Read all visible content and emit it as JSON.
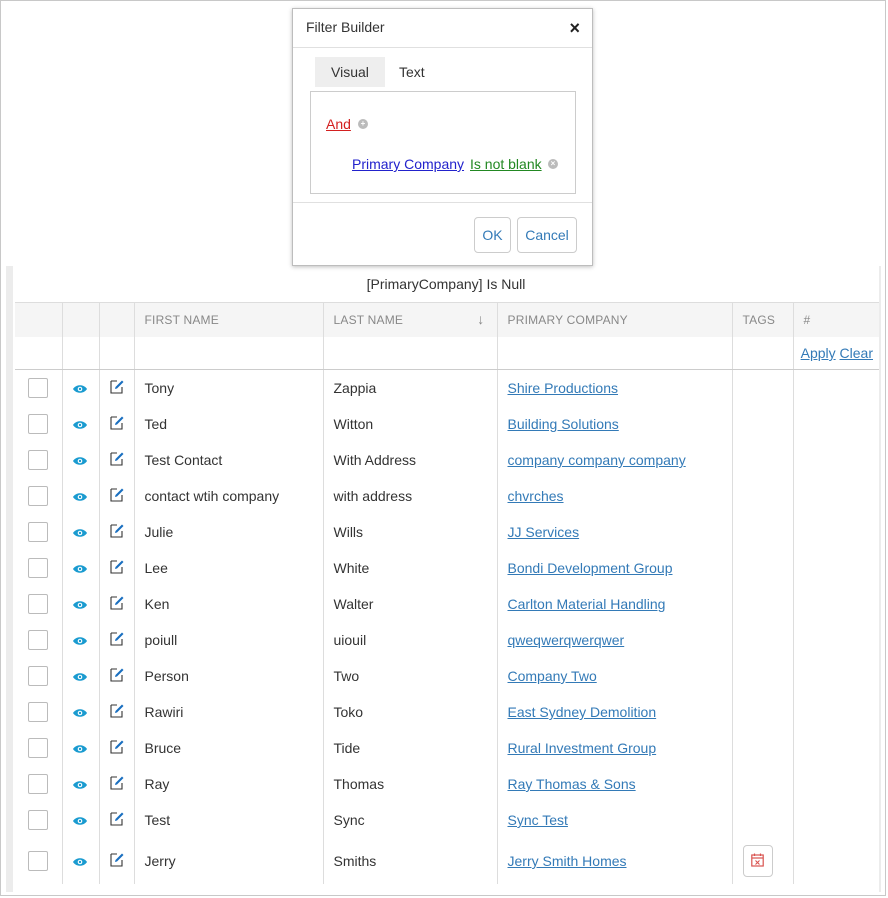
{
  "dialog": {
    "title": "Filter Builder",
    "close": "×",
    "tabs": [
      {
        "label": "Visual",
        "active": true
      },
      {
        "label": "Text",
        "active": false
      }
    ],
    "group_operator": "And",
    "condition": {
      "field": "Primary Company",
      "operator": "Is not blank"
    },
    "ok_label": "OK",
    "cancel_label": "Cancel"
  },
  "filter_expression": "[PrimaryCompany] Is Null",
  "grid": {
    "columns": {
      "first_name": "FIRST NAME",
      "last_name": "LAST NAME",
      "primary_company": "PRIMARY COMPANY",
      "tags": "TAGS",
      "hash": "#"
    },
    "sort_indicator": "↓",
    "filter_apply": "Apply",
    "filter_clear": "Clear",
    "rows": [
      {
        "first": "Tony",
        "last": "Zappia",
        "company": "Shire Productions"
      },
      {
        "first": "Ted",
        "last": "Witton",
        "company": "Building Solutions"
      },
      {
        "first": "Test Contact",
        "last": "With Address",
        "company": "company company company"
      },
      {
        "first": "contact wtih company",
        "last": "with address",
        "company": "chvrches"
      },
      {
        "first": "Julie",
        "last": "Wills",
        "company": "JJ Services"
      },
      {
        "first": "Lee",
        "last": "White",
        "company": "Bondi Development Group"
      },
      {
        "first": "Ken",
        "last": "Walter",
        "company": "Carlton Material Handling"
      },
      {
        "first": "poiull",
        "last": "uiouil",
        "company": "qweqwerqwerqwer"
      },
      {
        "first": "Person",
        "last": "Two",
        "company": "Company Two"
      },
      {
        "first": "Rawiri",
        "last": "Toko",
        "company": "East Sydney Demolition"
      },
      {
        "first": "Bruce",
        "last": "Tide",
        "company": "Rural Investment Group"
      },
      {
        "first": "Ray",
        "last": "Thomas",
        "company": "Ray Thomas & Sons"
      },
      {
        "first": "Test",
        "last": "Sync",
        "company": "Sync Test"
      },
      {
        "first": "Jerry",
        "last": "Smiths",
        "company": "Jerry Smith Homes"
      }
    ]
  },
  "colors": {
    "accent": "#337ab7",
    "view_icon": "#1a9bd0",
    "edit_icon": "#1a6fc0",
    "and": "#d32020",
    "operator": "#228822",
    "field": "#2222cc",
    "tag_icon": "#d9534f"
  }
}
